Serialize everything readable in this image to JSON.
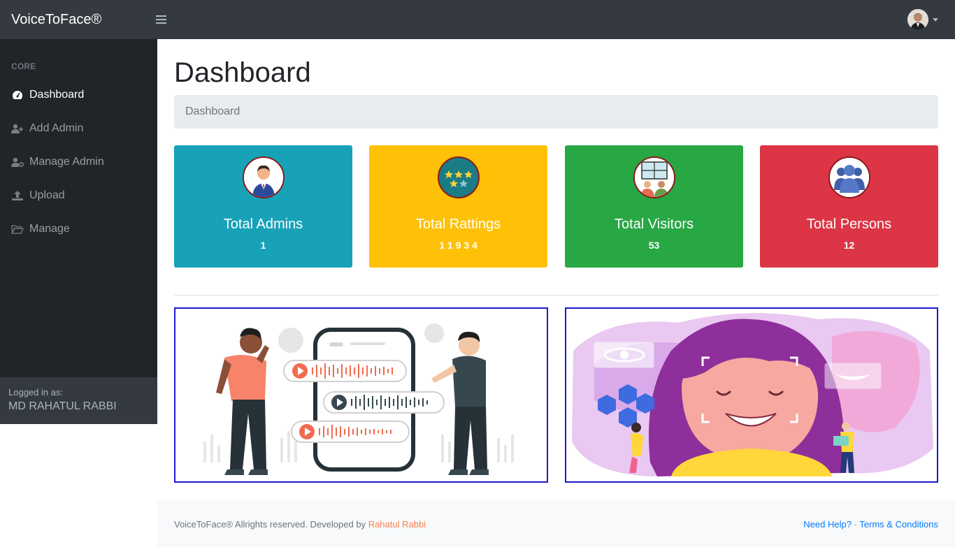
{
  "app": {
    "brand": "VoiceToFace®"
  },
  "sidebar": {
    "heading": "CORE",
    "items": [
      {
        "label": "Dashboard",
        "icon": "tachometer-icon"
      },
      {
        "label": "Add Admin",
        "icon": "user-plus-icon"
      },
      {
        "label": "Manage Admin",
        "icon": "user-cog-icon"
      },
      {
        "label": "Upload",
        "icon": "upload-icon"
      },
      {
        "label": "Manage",
        "icon": "folder-open-icon"
      }
    ],
    "footer": {
      "caption": "Logged in as:",
      "user": "MD RAHATUL RABBI"
    }
  },
  "main": {
    "title": "Dashboard",
    "breadcrumb": "Dashboard",
    "cards": [
      {
        "title": "Total Admins",
        "value": "1",
        "icon": "admin-avatar-icon",
        "color": "#17a2b8"
      },
      {
        "title": "Total Rattings",
        "value": "1 1 9 3 4",
        "icon": "stars-icon",
        "color": "#ffc107"
      },
      {
        "title": "Total Visitors",
        "value": "53",
        "icon": "visitors-icon",
        "color": "#28a745"
      },
      {
        "title": "Total Persons",
        "value": "12",
        "icon": "persons-group-icon",
        "color": "#dc3545"
      }
    ]
  },
  "footer": {
    "copyright": "VoiceToFace® Allrights reserved. Developed by",
    "author": "Rahatul Rabbi",
    "help": "Need Help?",
    "separator": "·",
    "terms": "Terms & Conditions"
  },
  "colors": {
    "topbar": "#343a40",
    "sidebar": "#212529",
    "accent_link": "#007bff",
    "author_link": "#fd7e4d",
    "illustration_border": "#1a1acd"
  }
}
